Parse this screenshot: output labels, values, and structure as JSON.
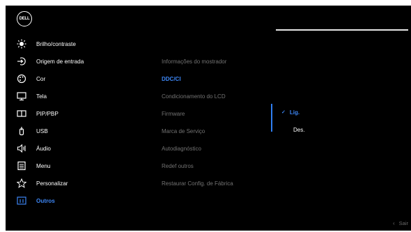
{
  "brand": {
    "logo_text": "DELL"
  },
  "nav": {
    "items": [
      {
        "label": "Brilho/contraste",
        "icon": "brightness-icon"
      },
      {
        "label": "Origem de entrada",
        "icon": "input-source-icon"
      },
      {
        "label": "Cor",
        "icon": "color-palette-icon"
      },
      {
        "label": "Tela",
        "icon": "display-monitor-icon"
      },
      {
        "label": "PIP/PBP",
        "icon": "pip-pbp-icon"
      },
      {
        "label": "USB",
        "icon": "usb-icon"
      },
      {
        "label": "Áudio",
        "icon": "speaker-icon"
      },
      {
        "label": "Menu",
        "icon": "menu-list-icon"
      },
      {
        "label": "Personalizar",
        "icon": "star-icon"
      },
      {
        "label": "Outros",
        "icon": "info-board-icon"
      }
    ],
    "active": "Outros"
  },
  "submenu": {
    "items": [
      {
        "label": "Informações do mostrador"
      },
      {
        "label": "DDC/CI"
      },
      {
        "label": "Condicionamento do LCD"
      },
      {
        "label": "Firmware"
      },
      {
        "label": "Marca de Serviço"
      },
      {
        "label": "Autodiagnóstico"
      },
      {
        "label": "Redef outros"
      },
      {
        "label": "Restaurar Config. de Fábrica"
      }
    ],
    "selected": "DDC/CI"
  },
  "options": {
    "on": "Lig.",
    "off": "Des.",
    "current": "Lig."
  },
  "footer": {
    "exit_label": "Sair"
  },
  "colors": {
    "accent": "#3d86f5",
    "background": "#000000",
    "muted": "#737373"
  }
}
